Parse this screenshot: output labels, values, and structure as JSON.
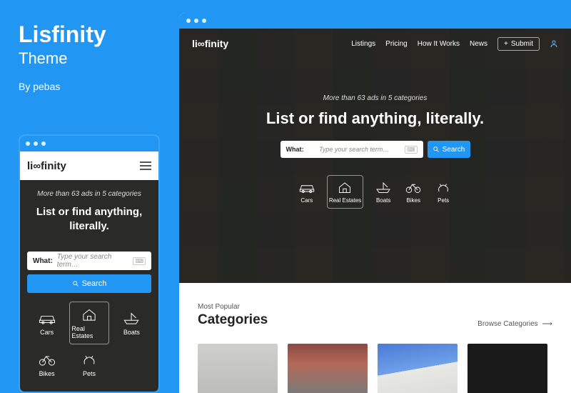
{
  "promo": {
    "title": "Lisfinity",
    "subtitle": "Theme",
    "author": "By pebas"
  },
  "shared": {
    "logo": "li∞finity",
    "tagline": "More than 63 ads in 5 categories",
    "headline_desktop": "List or find anything, literally.",
    "headline_mobile": "List or find anything, literally.",
    "search_what": "What:",
    "search_placeholder": "Type your search term…",
    "search_button": "Search"
  },
  "categories": [
    {
      "key": "cars",
      "label": "Cars"
    },
    {
      "key": "real-estates",
      "label": "Real Estates"
    },
    {
      "key": "boats",
      "label": "Boats"
    },
    {
      "key": "bikes",
      "label": "Bikes"
    },
    {
      "key": "pets",
      "label": "Pets"
    }
  ],
  "desktop_nav": {
    "items": [
      {
        "label": "Listings"
      },
      {
        "label": "Pricing"
      },
      {
        "label": "How It Works"
      },
      {
        "label": "News"
      }
    ],
    "submit": "Submit"
  },
  "section": {
    "label": "Most Popular",
    "title": "Categories",
    "browse": "Browse Categories"
  }
}
